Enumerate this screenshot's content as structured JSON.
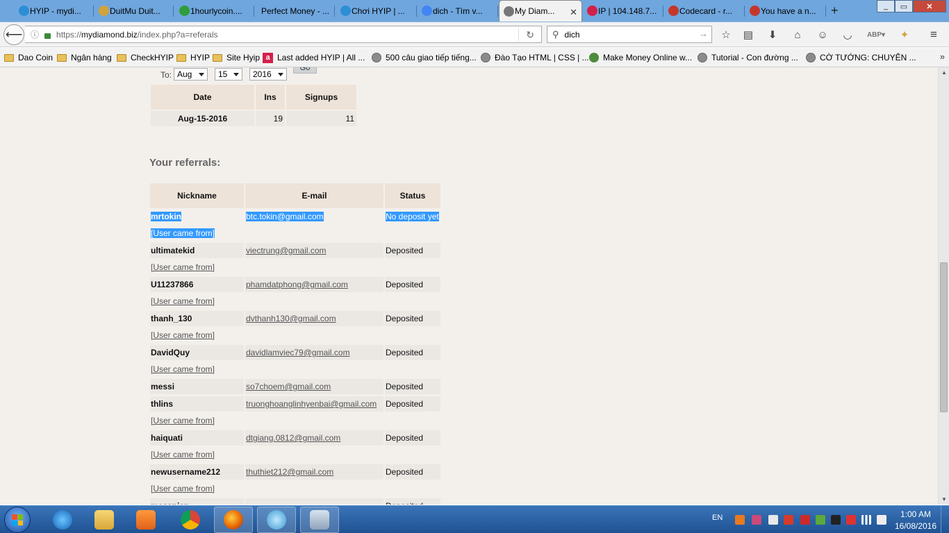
{
  "browser": {
    "tabs": [
      {
        "label": "HYIP - mydi...",
        "icon": "skype-icon",
        "color": "#2d8ed6"
      },
      {
        "label": "DuitMu Duit...",
        "icon": "coin-icon",
        "color": "#d1a33a"
      },
      {
        "label": "1hourlycoin....",
        "icon": "leaf-icon",
        "color": "#2f9d3a"
      },
      {
        "label": "Perfect Money - ...",
        "icon": "",
        "color": ""
      },
      {
        "label": "Chơi HYIP | ...",
        "icon": "skype-icon",
        "color": "#2d8ed6"
      },
      {
        "label": "dich - Tìm v...",
        "icon": "google-icon",
        "color": "#4285f4"
      },
      {
        "label": "My Diam...",
        "icon": "globe-icon",
        "color": "#777777",
        "active": true
      },
      {
        "label": "IP | 104.148.7...",
        "icon": "a-icon",
        "color": "#d3204b"
      },
      {
        "label": "Codecard - r...",
        "icon": "gmail-icon",
        "color": "#c5372c"
      },
      {
        "label": "You have a n...",
        "icon": "gmail-icon",
        "color": "#c5372c"
      }
    ],
    "url_prefix": "https://",
    "url_domain": "mydiamond.biz",
    "url_path": "/index.php?a=referals",
    "search_value": "dich",
    "bookmarks": [
      {
        "label": "Dao Coin",
        "icon": "folder"
      },
      {
        "label": "Ngân hàng",
        "icon": "folder"
      },
      {
        "label": "CheckHYIP",
        "icon": "folder"
      },
      {
        "label": "HYIP",
        "icon": "folder"
      },
      {
        "label": "Site Hyip",
        "icon": "folder"
      },
      {
        "label": "Last added HYIP | All ...",
        "icon": "red"
      },
      {
        "label": "500 câu giao tiếp tiếng...",
        "icon": "globe"
      },
      {
        "label": "Đào Tạo HTML | CSS | ...",
        "icon": "globe"
      },
      {
        "label": "Make Money Online w...",
        "icon": "green"
      },
      {
        "label": "Tutorial - Con đường ...",
        "icon": "globe"
      },
      {
        "label": "CỜ TƯỚNG: CHUYÊN ...",
        "icon": "globe"
      }
    ]
  },
  "filter": {
    "to_label": "To:",
    "month": "Aug",
    "day": "15",
    "year": "2016",
    "go_label": "Go"
  },
  "stats_table": {
    "headers": [
      "Date",
      "Ins",
      "Signups"
    ],
    "rows": [
      [
        "Aug-15-2016",
        "19",
        "11"
      ]
    ]
  },
  "referrals": {
    "title": "Your referrals:",
    "headers": [
      "Nickname",
      "E-mail",
      "Status"
    ],
    "came_from_label": "[User came from]",
    "rows": [
      {
        "nick": "mrtokin",
        "email": "btc.tokin@gmail.com",
        "status": "No deposit yet"
      },
      {
        "nick": "ultimatekid",
        "email": "viectrung@gmail.com",
        "status": "Deposited"
      },
      {
        "nick": "U11237866",
        "email": "phamdatphong@gmail.com",
        "status": "Deposited"
      },
      {
        "nick": "thanh_130",
        "email": "dvthanh130@gmail.com",
        "status": "Deposited"
      },
      {
        "nick": "DavidQuy",
        "email": "davidlamviec79@gmail.com",
        "status": "Deposited"
      },
      {
        "nick": "messi",
        "email": "so7choem@gmail.com",
        "status": "Deposited"
      },
      {
        "nick": "thlins",
        "email": "truonghoanglinhyenbai@gmail.com",
        "status": "Deposited"
      },
      {
        "nick": "haiquati",
        "email": "dtgiang.0812@gmail.com",
        "status": "Deposited"
      },
      {
        "nick": "newusername212",
        "email": "thuthiet212@gmail.com",
        "status": "Deposited"
      },
      {
        "nick": "messnian",
        "email": "...",
        "status": "Deposited"
      }
    ]
  },
  "taskbar": {
    "lang": "EN",
    "time": "1:00 AM",
    "date": "16/08/2016"
  }
}
